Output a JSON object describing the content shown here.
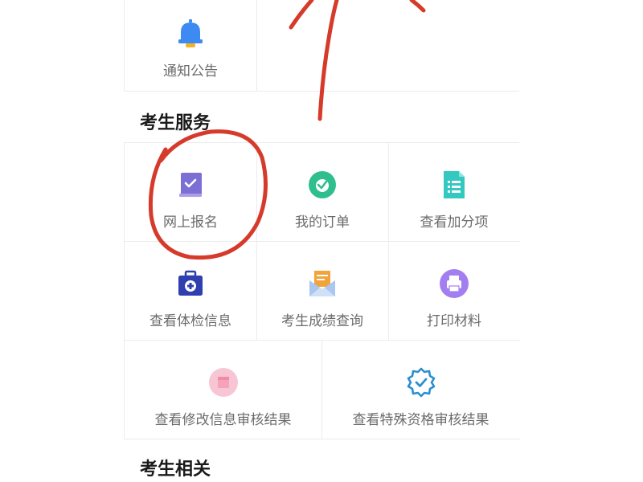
{
  "notice": {
    "label": "通知公告",
    "icon": "bell-icon"
  },
  "candidate_services": {
    "title": "考生服务",
    "items": [
      {
        "label": "网上报名",
        "icon": "registration-book-icon"
      },
      {
        "label": "我的订单",
        "icon": "order-check-icon"
      },
      {
        "label": "查看加分项",
        "icon": "document-list-icon"
      },
      {
        "label": "查看体检信息",
        "icon": "medical-kit-icon"
      },
      {
        "label": "考生成绩查询",
        "icon": "envelope-letter-icon"
      },
      {
        "label": "打印材料",
        "icon": "printer-icon"
      },
      {
        "label": "查看修改信息审核结果",
        "icon": "pink-card-icon"
      },
      {
        "label": "查看特殊资格审核结果",
        "icon": "verified-badge-icon"
      }
    ]
  },
  "candidate_related": {
    "title": "考生相关"
  },
  "colors": {
    "annotation": "#d63a2a",
    "bell": "#3d8bf2",
    "bell_base": "#f5b324",
    "purple": "#7b6fd6",
    "green": "#2fbf8f",
    "teal": "#33c9c1",
    "navy": "#2f3fb0",
    "orange": "#f2a33a",
    "lavender": "#a27ef0",
    "pink": "#f7c5d3",
    "blue_badge": "#2b8fd0"
  }
}
